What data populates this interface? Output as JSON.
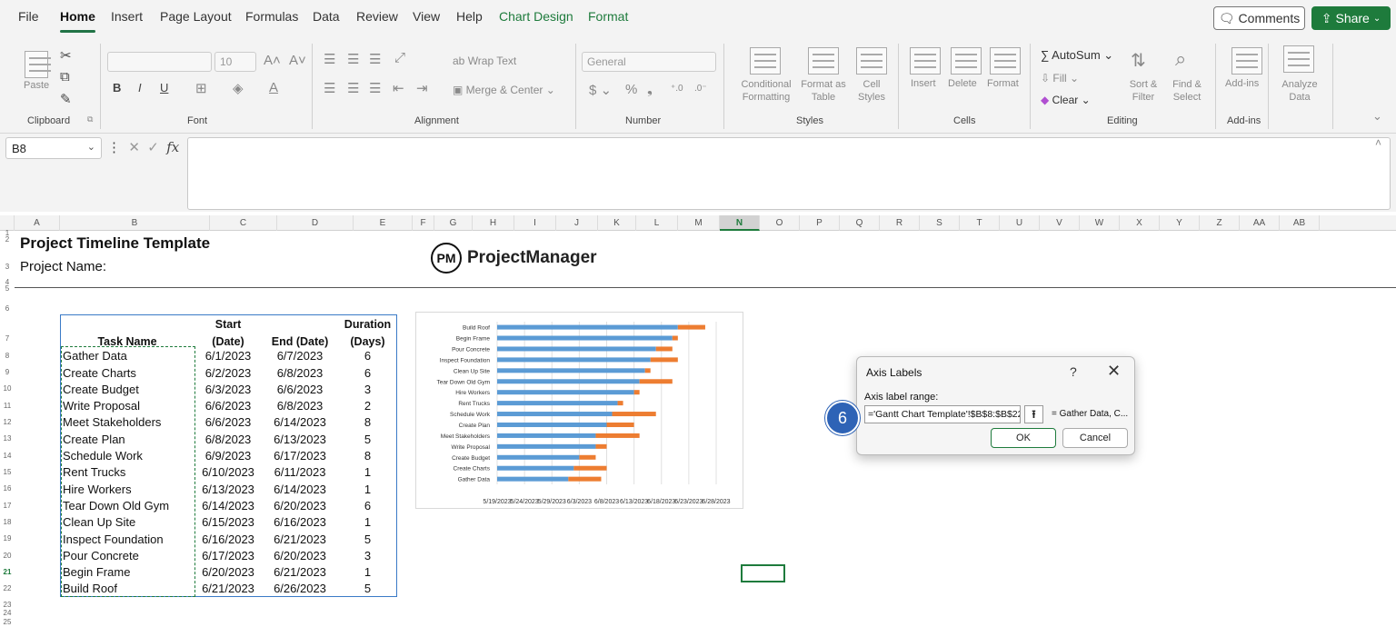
{
  "menus": [
    "File",
    "Home",
    "Insert",
    "Page Layout",
    "Formulas",
    "Data",
    "Review",
    "View",
    "Help",
    "Chart Design",
    "Format"
  ],
  "top_buttons": {
    "comments": "Comments",
    "share": "Share"
  },
  "ribbon": {
    "clipboard": {
      "paste": "Paste",
      "label": "Clipboard"
    },
    "font": {
      "size": "10",
      "label": "Font"
    },
    "alignment": {
      "wrap": "Wrap Text",
      "merge": "Merge & Center",
      "label": "Alignment"
    },
    "number": {
      "format": "General",
      "label": "Number"
    },
    "styles": {
      "cond": "Conditional Formatting",
      "fmt_table": "Format as Table",
      "cell_styles": "Cell Styles",
      "label": "Styles"
    },
    "cells": {
      "insert": "Insert",
      "delete": "Delete",
      "format": "Format",
      "label": "Cells"
    },
    "editing": {
      "autosum": "AutoSum",
      "fill": "Fill",
      "clear": "Clear",
      "sort": "Sort & Filter",
      "find": "Find & Select",
      "label": "Editing"
    },
    "addins": {
      "addins": "Add-ins",
      "analyze": "Analyze Data",
      "label": "Add-ins"
    }
  },
  "formula_bar": {
    "cell_ref": "B8",
    "fx": "fx"
  },
  "columns": [
    "A",
    "B",
    "C",
    "D",
    "E",
    "F",
    "G",
    "H",
    "I",
    "J",
    "K",
    "L",
    "M",
    "N",
    "O",
    "P",
    "Q",
    "R",
    "S",
    "T",
    "U",
    "V",
    "W",
    "X",
    "Y",
    "Z",
    "AA",
    "AB"
  ],
  "selected_column": "N",
  "selected_row": "21",
  "rows": [
    "1",
    "2",
    "3",
    "4",
    "5",
    "6",
    "7",
    "8",
    "9",
    "10",
    "11",
    "12",
    "13",
    "14",
    "15",
    "16",
    "17",
    "18",
    "19",
    "20",
    "21",
    "22",
    "23",
    "24",
    "25"
  ],
  "sheet": {
    "title": "Project Timeline Template",
    "project_name_label": "Project Name:",
    "brand": "ProjectManager",
    "brand_mark": "PM"
  },
  "table": {
    "headers": {
      "task": "Task Name",
      "start_top": "Start",
      "start_bottom": "(Date)",
      "end": "End  (Date)",
      "dur_top": "Duration",
      "dur_bottom": "(Days)"
    },
    "rows": [
      [
        "Gather Data",
        "6/1/2023",
        "6/7/2023",
        "6"
      ],
      [
        "Create Charts",
        "6/2/2023",
        "6/8/2023",
        "6"
      ],
      [
        "Create Budget",
        "6/3/2023",
        "6/6/2023",
        "3"
      ],
      [
        "Write Proposal",
        "6/6/2023",
        "6/8/2023",
        "2"
      ],
      [
        "Meet Stakeholders",
        "6/6/2023",
        "6/14/2023",
        "8"
      ],
      [
        "Create Plan",
        "6/8/2023",
        "6/13/2023",
        "5"
      ],
      [
        "Schedule Work",
        "6/9/2023",
        "6/17/2023",
        "8"
      ],
      [
        "Rent Trucks",
        "6/10/2023",
        "6/11/2023",
        "1"
      ],
      [
        "Hire Workers",
        "6/13/2023",
        "6/14/2023",
        "1"
      ],
      [
        "Tear Down Old Gym",
        "6/14/2023",
        "6/20/2023",
        "6"
      ],
      [
        "Clean Up Site",
        "6/15/2023",
        "6/16/2023",
        "1"
      ],
      [
        "Inspect Foundation",
        "6/16/2023",
        "6/21/2023",
        "5"
      ],
      [
        "Pour Concrete",
        "6/17/2023",
        "6/20/2023",
        "3"
      ],
      [
        "Begin Frame",
        "6/20/2023",
        "6/21/2023",
        "1"
      ],
      [
        "Build Roof",
        "6/21/2023",
        "6/26/2023",
        "5"
      ]
    ]
  },
  "chart_data": {
    "type": "bar",
    "orientation": "horizontal-stacked",
    "categories": [
      "Build Roof",
      "Begin Frame",
      "Pour Concrete",
      "Inspect Foundation",
      "Clean Up Site",
      "Tear Down Old Gym",
      "Hire Workers",
      "Rent Trucks",
      "Schedule Work",
      "Create Plan",
      "Meet Stakeholders",
      "Write Proposal",
      "Create Budget",
      "Create Charts",
      "Gather Data"
    ],
    "start_dates": [
      "2023-06-21",
      "2023-06-20",
      "2023-06-17",
      "2023-06-16",
      "2023-06-15",
      "2023-06-14",
      "2023-06-13",
      "2023-06-10",
      "2023-06-09",
      "2023-06-08",
      "2023-06-06",
      "2023-06-06",
      "2023-06-03",
      "2023-06-02",
      "2023-06-01"
    ],
    "durations": [
      5,
      1,
      3,
      5,
      1,
      6,
      1,
      1,
      8,
      5,
      8,
      2,
      3,
      6,
      6
    ],
    "x_ticks": [
      "5/19/2023",
      "5/24/2023",
      "5/29/2023",
      "6/3/2023",
      "6/8/2023",
      "6/13/2023",
      "6/18/2023",
      "6/23/2023",
      "6/28/2023"
    ],
    "xlim": [
      "2023-05-19",
      "2023-06-28"
    ],
    "series_colors": {
      "start": "#5b9bd5",
      "duration": "#ed7d31"
    },
    "grid": true
  },
  "dialog": {
    "title": "Axis Labels",
    "help": "?",
    "close": "✕",
    "range_label": "Axis label range:",
    "range_value": "='Gantt Chart Template'!$B$8:$B$22",
    "preview": "= Gather Data, C...",
    "ok": "OK",
    "cancel": "Cancel"
  },
  "step_marker": "6",
  "colors": {
    "accent": "#1e7b3c",
    "step": "#2e63b6"
  }
}
